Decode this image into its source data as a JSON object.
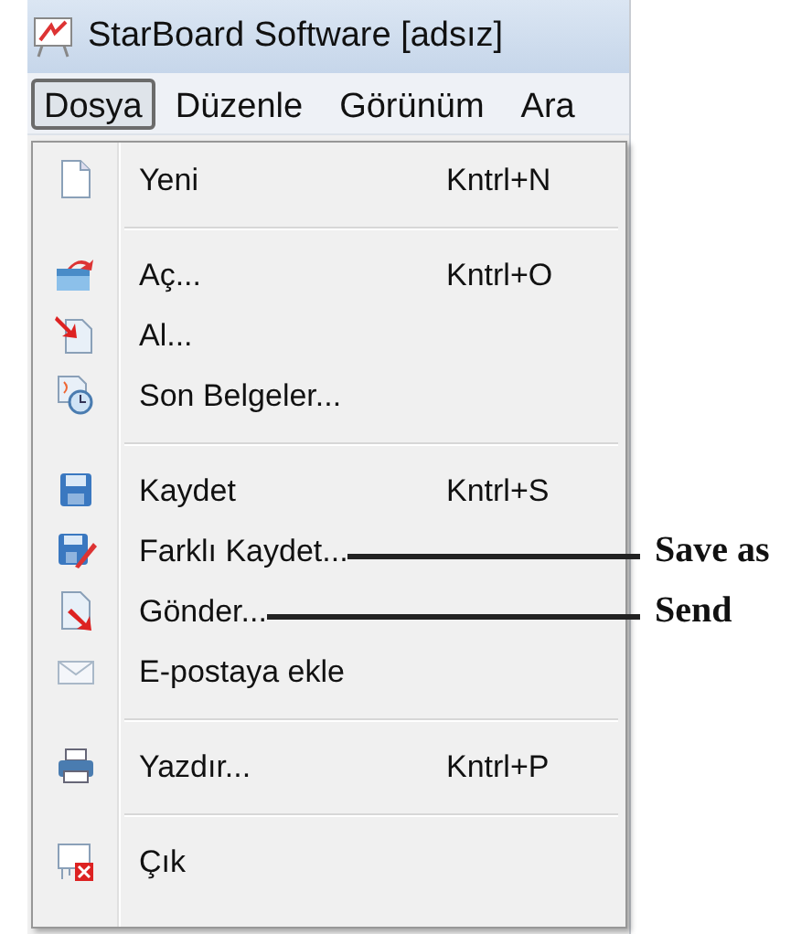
{
  "window": {
    "title": "StarBoard Software [adsız]"
  },
  "menu_bar": [
    {
      "label": "Dosya",
      "selected": true
    },
    {
      "label": "Düzenle",
      "selected": false
    },
    {
      "label": "Görünüm",
      "selected": false
    },
    {
      "label": "Ara",
      "selected": false
    }
  ],
  "menu": [
    {
      "kind": "item",
      "label": "Yeni",
      "shortcut": "Kntrl+N"
    },
    {
      "kind": "separator"
    },
    {
      "kind": "item",
      "label": "Aç...",
      "shortcut": "Kntrl+O"
    },
    {
      "kind": "item",
      "label": "Al..."
    },
    {
      "kind": "item",
      "label": "Son Belgeler..."
    },
    {
      "kind": "separator"
    },
    {
      "kind": "item",
      "label": "Kaydet",
      "shortcut": "Kntrl+S"
    },
    {
      "kind": "item",
      "label": "Farklı Kaydet...",
      "annotation": "Save as"
    },
    {
      "kind": "item",
      "label": "Gönder...",
      "annotation": "Send"
    },
    {
      "kind": "item",
      "label": "E-postaya ekle"
    },
    {
      "kind": "separator"
    },
    {
      "kind": "item",
      "label": "Yazdır...",
      "shortcut": "Kntrl+P"
    },
    {
      "kind": "separator"
    },
    {
      "kind": "item",
      "label": "Çık"
    }
  ]
}
